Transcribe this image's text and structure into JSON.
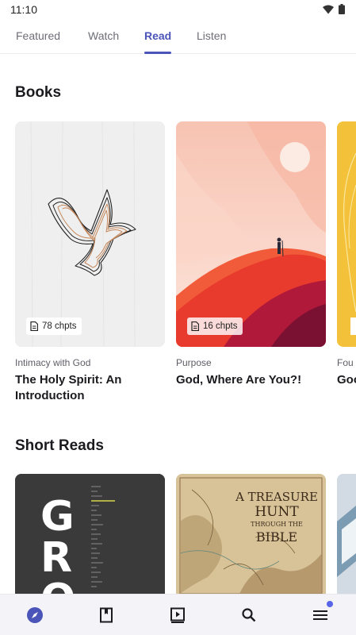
{
  "status_bar": {
    "time": "11:10"
  },
  "tabs": [
    {
      "label": "Featured",
      "active": false
    },
    {
      "label": "Watch",
      "active": false
    },
    {
      "label": "Read",
      "active": true
    },
    {
      "label": "Listen",
      "active": false
    }
  ],
  "colors": {
    "accent": "#4b54b8",
    "nav_dot": "#5865e8"
  },
  "books": {
    "title": "Books",
    "items": [
      {
        "chapters": "78 chpts",
        "category": "Intimacy with God",
        "title": "The Holy Spirit: An Introduction"
      },
      {
        "chapters": "16 chpts",
        "category": "Purpose",
        "title": "God, Where Are You?!"
      },
      {
        "category": "Fou",
        "title": "Goo"
      }
    ]
  },
  "short_reads": {
    "title": "Short Reads",
    "items": [
      {
        "cover_text": "GRO"
      },
      {
        "cover_text": [
          "A TREASURE",
          "HUNT",
          "THROUGH THE",
          "BIBLE"
        ]
      }
    ]
  },
  "bottom_nav": [
    {
      "icon": "compass-icon",
      "active": true
    },
    {
      "icon": "book-icon",
      "active": false
    },
    {
      "icon": "video-icon",
      "active": false
    },
    {
      "icon": "search-icon",
      "active": false
    },
    {
      "icon": "menu-icon",
      "active": false,
      "has_dot": true
    }
  ]
}
